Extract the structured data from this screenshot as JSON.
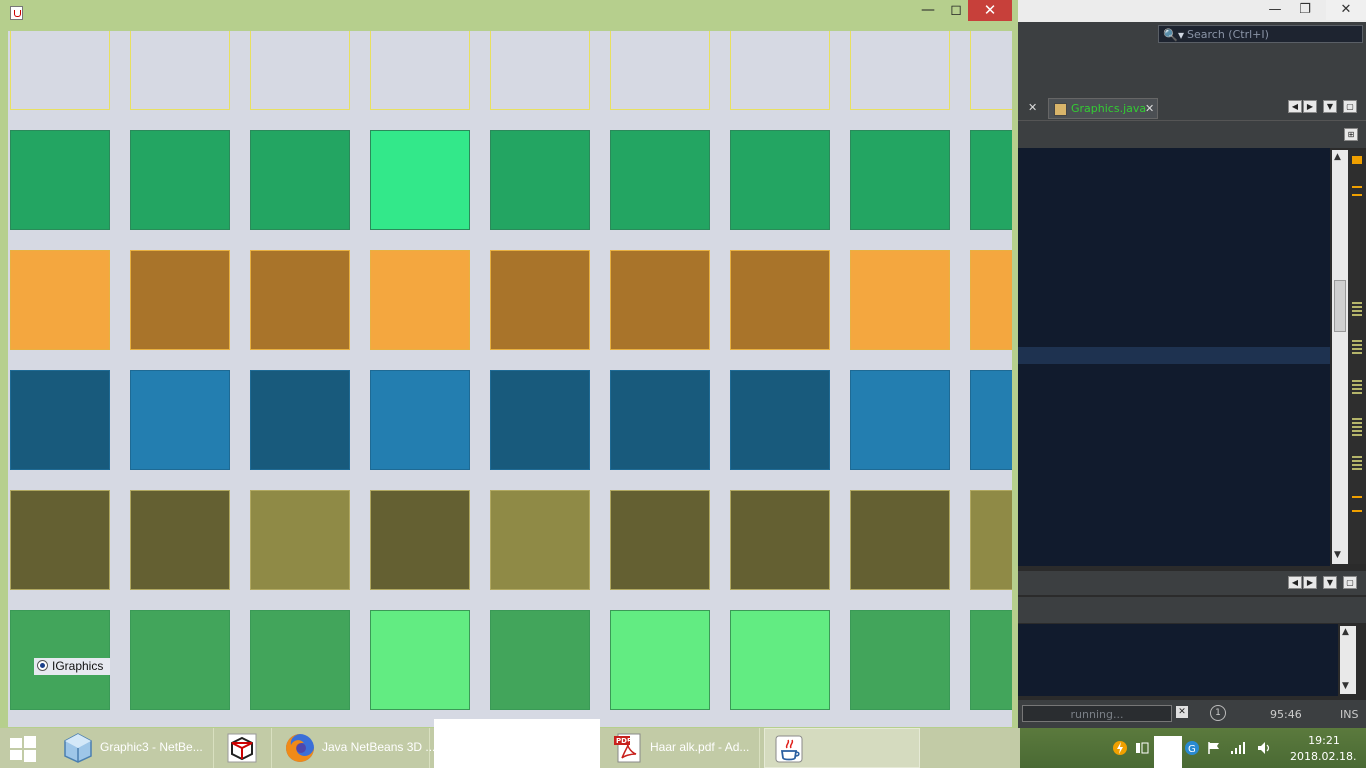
{
  "ide": {
    "search_placeholder": "Search (Ctrl+I)",
    "active_tab_label": "Graphics.java",
    "status_text": "running...",
    "cursor_position": "95:46",
    "insert_mode": "INS"
  },
  "app": {
    "radio_label": "IGraphics",
    "grid_rows": [
      {
        "light": "#d6d9e3",
        "dark": "#d6d9e3",
        "pattern": "000000000",
        "border": "#e8e060"
      },
      {
        "light": "#33e88a",
        "dark": "#23a562",
        "pattern": "000100000",
        "border": "#2a8a5a"
      },
      {
        "light": "#f4a73f",
        "dark": "#a9742a",
        "pattern": "100100011",
        "border": "#e8b040"
      },
      {
        "light": "#237eb0",
        "dark": "#185a7c",
        "pattern": "010100011",
        "border": "#1e6a94"
      },
      {
        "light": "#8f8a46",
        "dark": "#646032",
        "pattern": "001010001",
        "border": "#b0a860"
      },
      {
        "light": "#62ec82",
        "dark": "#42a55b",
        "pattern": "000101100",
        "border": "#3a9a56"
      }
    ],
    "colors": {
      "title_bar": "#b6cf8d",
      "close_button": "#c7403a",
      "canvas_background": "#d6d9e3"
    }
  },
  "taskbar": {
    "items": [
      {
        "label": "Graphic3 - NetBe...",
        "icon": "netbeans-icon"
      },
      {
        "label": "",
        "icon": "virtualbox-icon"
      },
      {
        "label": "Java NetBeans 3D ...",
        "icon": "firefox-icon"
      },
      {
        "label": "Haar alk.pdf - Ad...",
        "icon": "pdf-icon"
      },
      {
        "label": "",
        "icon": "java-icon"
      }
    ],
    "tray": {
      "time": "19:21",
      "date": "2018.02.18."
    }
  }
}
